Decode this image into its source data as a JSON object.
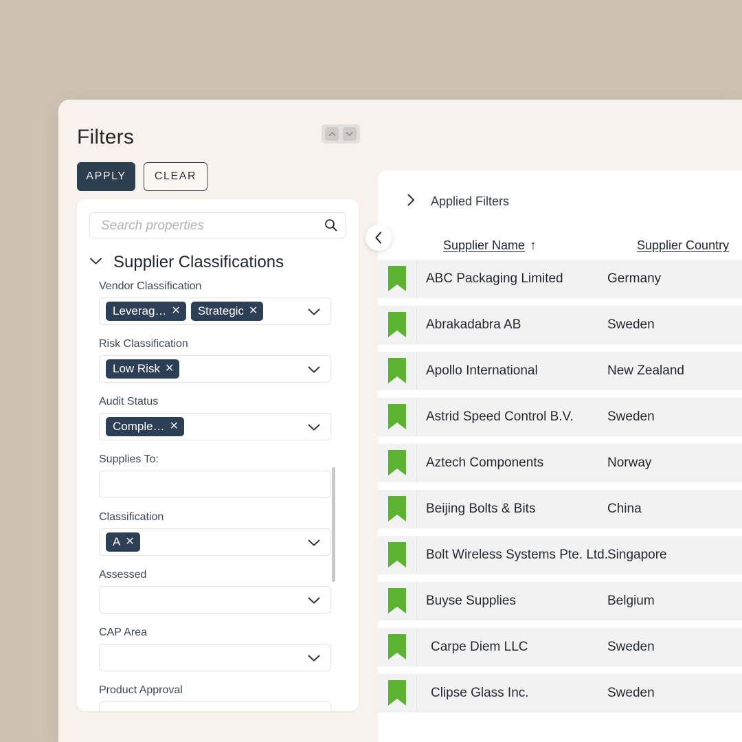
{
  "header": {
    "title": "Filters",
    "apply_label": "APPLY",
    "clear_label": "CLEAR",
    "view_toggle": {
      "up_icon": "chevron-up-icon",
      "down_icon": "chevron-down-icon"
    }
  },
  "search": {
    "placeholder": "Search properties",
    "value": "",
    "icon": "search-icon"
  },
  "filter_group": {
    "label": "Supplier Classifications",
    "expanded": true,
    "chevron_icon": "chevron-down-icon"
  },
  "fields": [
    {
      "label": "Vendor Classification",
      "type": "multiselect",
      "has_caret": true,
      "chips": [
        "Leverag…",
        "Strategic"
      ]
    },
    {
      "label": "Risk Classification",
      "type": "multiselect",
      "has_caret": true,
      "chips": [
        "Low Risk"
      ]
    },
    {
      "label": "Audit Status",
      "type": "multiselect",
      "has_caret": true,
      "chips": [
        "Comple…"
      ]
    },
    {
      "label": "Supplies To:",
      "type": "text",
      "has_caret": false,
      "chips": []
    },
    {
      "label": "Classification",
      "type": "multiselect",
      "has_caret": true,
      "chips": [
        "A"
      ]
    },
    {
      "label": "Assessed",
      "type": "select",
      "has_caret": true,
      "chips": []
    },
    {
      "label": "CAP Area",
      "type": "select",
      "has_caret": true,
      "chips": []
    },
    {
      "label": "Product Approval",
      "type": "select",
      "has_caret": true,
      "chips": []
    }
  ],
  "results": {
    "applied_filters_label": "Applied Filters",
    "applied_filters_icon": "chevron-right-icon",
    "collapse_icon": "chevron-left-icon",
    "columns": [
      {
        "label": "Supplier Name",
        "sorted": "asc",
        "sort_glyph": "↑"
      },
      {
        "label": "Supplier Country",
        "sorted": "none",
        "sort_glyph": ""
      }
    ],
    "rows": [
      {
        "flag": "bookmark-icon",
        "name": "ABC Packaging Limited",
        "country": "Germany",
        "indent": false
      },
      {
        "flag": "bookmark-icon",
        "name": "Abrakadabra AB",
        "country": "Sweden",
        "indent": false
      },
      {
        "flag": "bookmark-icon",
        "name": "Apollo International",
        "country": "New Zealand",
        "indent": false
      },
      {
        "flag": "bookmark-icon",
        "name": "Astrid Speed Control B.V.",
        "country": "Sweden",
        "indent": false
      },
      {
        "flag": "bookmark-icon",
        "name": "Aztech Components",
        "country": "Norway",
        "indent": false
      },
      {
        "flag": "bookmark-icon",
        "name": "Beijing Bolts & Bits",
        "country": "China",
        "indent": false
      },
      {
        "flag": "bookmark-icon",
        "name": "Bolt Wireless Systems Pte. Ltd.",
        "country": "Singapore",
        "indent": false
      },
      {
        "flag": "bookmark-icon",
        "name": "Buyse Supplies",
        "country": "Belgium",
        "indent": false
      },
      {
        "flag": "bookmark-icon",
        "name": "Carpe Diem LLC",
        "country": "Sweden",
        "indent": true
      },
      {
        "flag": "bookmark-icon",
        "name": "Clipse Glass Inc.",
        "country": "Sweden",
        "indent": true
      }
    ]
  },
  "colors": {
    "page_background": "#cdc2b4",
    "card_background": "#f7f2ec",
    "panel_background": "#ffffff",
    "accent_dark": "#2c3e50",
    "chip_background": "#2d3f54",
    "flag_green": "#5cb331",
    "row_background": "#f2f2f2"
  }
}
